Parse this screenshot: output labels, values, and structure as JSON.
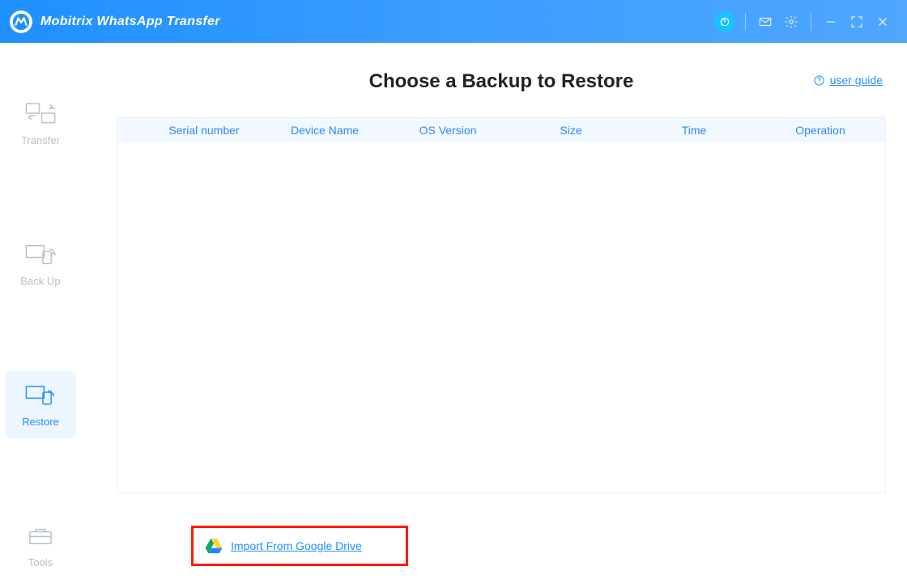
{
  "header": {
    "app_title": "Mobitrix WhatsApp Transfer"
  },
  "sidebar": {
    "items": [
      {
        "id": "transfer",
        "label": "Transfer",
        "active": false
      },
      {
        "id": "backup",
        "label": "Back Up",
        "active": false
      },
      {
        "id": "restore",
        "label": "Restore",
        "active": true
      },
      {
        "id": "tools",
        "label": "Tools",
        "active": false
      }
    ]
  },
  "main": {
    "page_title": "Choose a Backup to Restore",
    "user_guide_label": "user guide",
    "table": {
      "columns": {
        "serial_number": "Serial number",
        "device_name": "Device Name",
        "os_version": "OS Version",
        "size": "Size",
        "time": "Time",
        "operation": "Operation"
      },
      "rows": []
    },
    "import_link_label": "Import From Google Drive"
  }
}
